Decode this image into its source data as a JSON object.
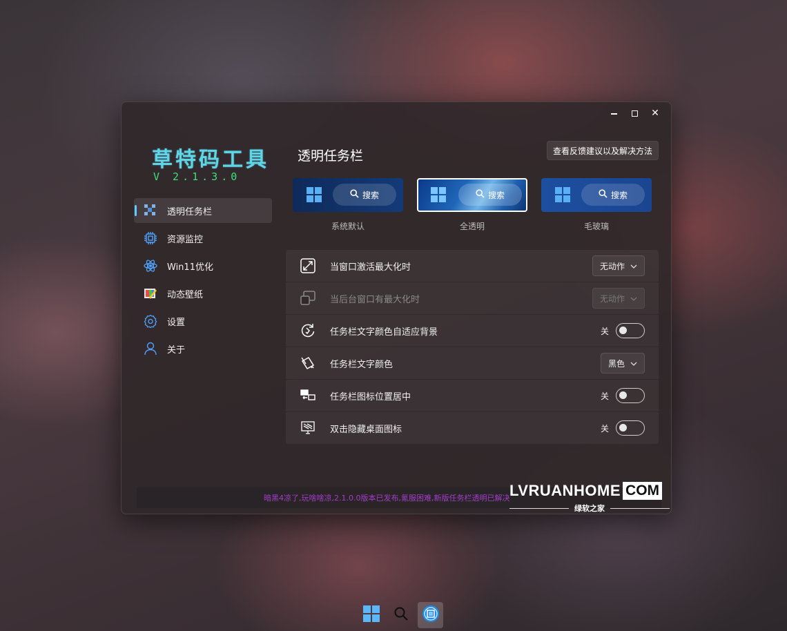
{
  "window": {
    "controls": {
      "minimize": "",
      "maximize": "",
      "close": "✕"
    }
  },
  "sidebar": {
    "app_title": "草特码工具",
    "app_version": "V 2.1.3.0",
    "items": [
      {
        "label": "透明任务栏",
        "icon": "taskbar-checker-icon",
        "active": true
      },
      {
        "label": "资源监控",
        "icon": "chip-icon",
        "active": false
      },
      {
        "label": "Win11优化",
        "icon": "atom-icon",
        "active": false
      },
      {
        "label": "动态壁纸",
        "icon": "wallpaper-icon",
        "active": false
      },
      {
        "label": "设置",
        "icon": "gear-icon",
        "active": false
      },
      {
        "label": "关于",
        "icon": "user-icon",
        "active": false
      }
    ]
  },
  "main": {
    "title": "透明任务栏",
    "feedback_button": "查看反馈建议以及解决方法",
    "previews": [
      {
        "label": "系统默认",
        "search": "搜索",
        "selected": false
      },
      {
        "label": "全透明",
        "search": "搜索",
        "selected": true
      },
      {
        "label": "毛玻璃",
        "search": "搜索",
        "selected": false
      }
    ],
    "settings": [
      {
        "label": "当窗口激活最大化时",
        "icon": "maximize-window-icon",
        "control": "dropdown",
        "value": "无动作",
        "disabled": false
      },
      {
        "label": "当后台窗口有最大化时",
        "icon": "background-window-icon",
        "control": "dropdown",
        "value": "无动作",
        "disabled": true
      },
      {
        "label": "任务栏文字颜色自适应背景",
        "icon": "adaptive-color-icon",
        "control": "toggle",
        "value": "关",
        "disabled": false
      },
      {
        "label": "任务栏文字颜色",
        "icon": "text-color-icon",
        "control": "dropdown",
        "value": "黑色",
        "disabled": false
      },
      {
        "label": "任务栏图标位置居中",
        "icon": "center-icons-icon",
        "control": "toggle",
        "value": "关",
        "disabled": false
      },
      {
        "label": "双击隐藏桌面图标",
        "icon": "hide-desktop-icon",
        "control": "toggle",
        "value": "关",
        "disabled": false
      }
    ]
  },
  "status": {
    "text": "暗黑4凉了,玩啥啥凉,2.1.0.0版本已发布,氪服困难,新版任务栏透明已解决"
  },
  "watermark": {
    "left": "LVRUANHOME",
    "box": "COM",
    "sub": "绿软之家"
  },
  "taskbar": {
    "items": [
      "start-icon",
      "search-icon",
      "app-icon"
    ]
  },
  "colors": {
    "accent": "#60cdff",
    "title": "#5fd6e8",
    "version": "#3de07a",
    "status": "#a23ec8"
  }
}
